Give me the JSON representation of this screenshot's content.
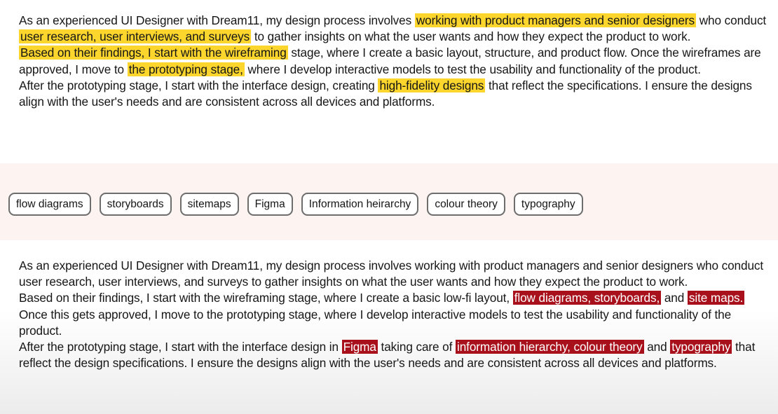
{
  "top": {
    "p1": {
      "s1": "As an experienced UI Designer with Dream11, my design process involves ",
      "h1": "working with product managers and senior designers",
      "s2": " who conduct ",
      "h2": "user research, user interviews, and surveys",
      "s3": " to gather insights on what the user wants and how they expect the product to work."
    },
    "p2": {
      "h1": "Based on their findings, I start with the wireframing",
      "s1": " stage, where I create a basic layout, structure, and product flow. Once the wireframes are approved, I move to ",
      "h2": "the prototyping stage,",
      "s2": " where I develop interactive models to test the usability and functionality of the product."
    },
    "p3": {
      "s1": "After the prototyping stage, I start with the interface design, creating ",
      "h1": "high-fidelity designs",
      "s2": " that reflect the specifications. I ensure the designs align with the user's needs and are consistent across all devices and platforms."
    }
  },
  "chips": [
    "flow diagrams",
    "storyboards",
    "sitemaps",
    "Figma",
    "Information heirarchy",
    "colour theory",
    "typography"
  ],
  "bottom": {
    "p1": {
      "s1": "As an experienced UI Designer with Dream11, my design process involves working with product managers and senior designers who conduct user research, user interviews, and surveys to gather insights on what the user wants and how they expect the product to work."
    },
    "p2": {
      "s1": "Based on their findings, I start with the wireframing stage, where I create a basic low-fi layout, ",
      "h1": "flow diagrams, storyboards,",
      "s2": " and ",
      "h2": "site maps.",
      "s3": " Once this gets approved, I move to the prototyping stage, where I develop interactive models to test the usability and functionality of the product."
    },
    "p3": {
      "s1": "After the prototyping stage, I start with the interface design in ",
      "h1": "Figma",
      "s2": " taking care of ",
      "h2": "information hierarchy, colour theory",
      "s3": " and ",
      "h3": "typography",
      "s4": " that reflect the design specifications. I ensure the designs align with the user's needs and are consistent across all devices and platforms."
    }
  },
  "colors": {
    "highlight_yellow": "#fcd52d",
    "highlight_red": "#a8111b",
    "band_background": "#fdf3f1"
  }
}
